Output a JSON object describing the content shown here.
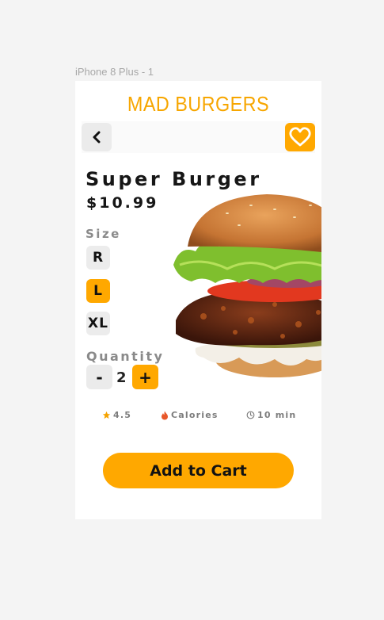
{
  "artboard": {
    "name": "iPhone 8 Plus - 1"
  },
  "header": {
    "brand": "MAD BURGERS"
  },
  "nav": {
    "back_icon": "chevron-left-icon",
    "favorite_icon": "heart-icon"
  },
  "product": {
    "name": "Super Burger",
    "price": "$10.99"
  },
  "size": {
    "label": "Size",
    "options": [
      "R",
      "L",
      "XL"
    ],
    "selected": "L"
  },
  "quantity": {
    "label": "Quantity",
    "minus": "-",
    "value": "2",
    "plus": "+"
  },
  "info": {
    "rating": "4.5",
    "calories": "Calories",
    "time": "10 min"
  },
  "cta": {
    "label": "Add to Cart"
  },
  "colors": {
    "accent": "#ffa800",
    "brand": "#f7a600",
    "text": "#161616",
    "muted": "#8a8a8a",
    "surface": "#ececec"
  }
}
